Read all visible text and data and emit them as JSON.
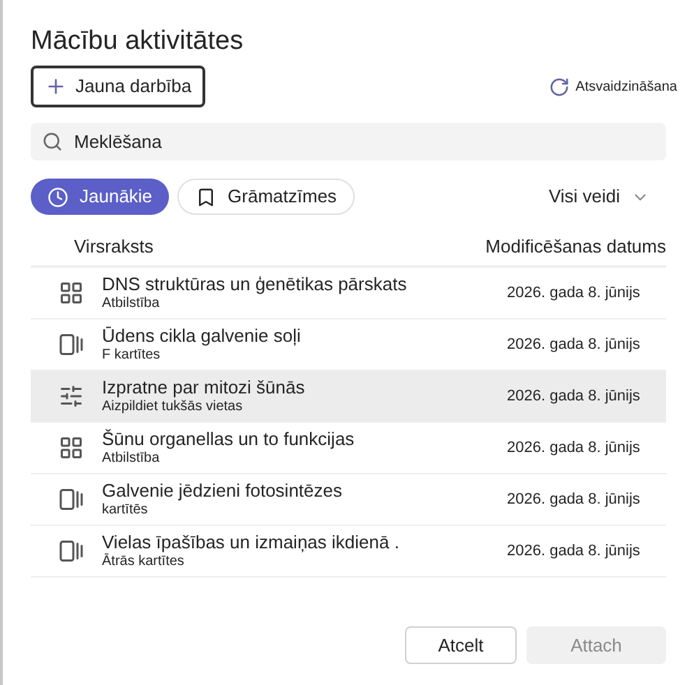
{
  "title": "Mācību aktivitātes",
  "new_button": "Jauna darbība",
  "refresh_button": "Atsvaidzināšana",
  "search": {
    "placeholder": "Meklēšana"
  },
  "filters": [
    {
      "label": "Jaunākie",
      "kind": "recent",
      "selected": true
    },
    {
      "label": "Grāmatzīmes",
      "kind": "bookmark",
      "selected": false
    }
  ],
  "type_dropdown": "Visi veidi",
  "table": {
    "columns": [
      "Virsraksts",
      "Modificēšanas datums"
    ],
    "rows": [
      {
        "title": "DNS struktūras un ģenētikas pārskats",
        "type": "Atbilstība",
        "kind": "matching",
        "date": "2026. gada 8. jūnijs",
        "highlighted": false
      },
      {
        "title": "Ūdens cikla galvenie soļi",
        "type": "F kartītes",
        "kind": "flashcards",
        "date": "2026. gada 8. jūnijs",
        "highlighted": false
      },
      {
        "title": "Izpratne par mitozi šūnās",
        "type": "Aizpildiet tukšās vietas",
        "kind": "fill_blanks",
        "date": "2026. gada 8. jūnijs",
        "highlighted": true
      },
      {
        "title": "Šūnu organellas un to funkcijas",
        "type": "Atbilstība",
        "kind": "matching",
        "date": "2026. gada 8. jūnijs",
        "highlighted": false
      },
      {
        "title": "Galvenie jēdzieni fotosintēzes",
        "type": "kartītēs",
        "kind": "flashcards",
        "date": "2026. gada 8. jūnijs",
        "highlighted": false
      },
      {
        "title": "Vielas īpašības un izmaiņas ikdienā .",
        "type": "Ātrās kartītes",
        "kind": "flashcards",
        "date": "2026. gada 8. jūnijs",
        "highlighted": false
      }
    ]
  },
  "buttons": [
    {
      "label": "Atcelt",
      "disabled": false
    },
    {
      "label": "Attach",
      "disabled": true
    }
  ]
}
